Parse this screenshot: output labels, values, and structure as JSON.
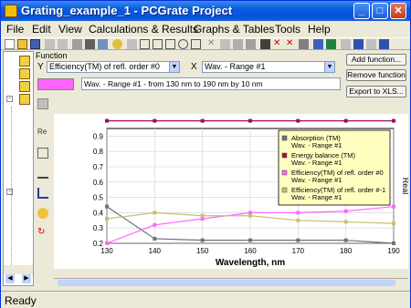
{
  "window": {
    "title": "Grating_example_1 - PCGrate Project",
    "minimize_label": "_",
    "maximize_label": "□",
    "close_label": "✕"
  },
  "menu": [
    "File",
    "Edit",
    "View",
    "Calculations & Results",
    "Graphs & Tables",
    "Tools",
    "Help"
  ],
  "function_panel": {
    "group_label": "Function",
    "y_label": "Y",
    "y_value": "Efficiency(TM) of refl. order #0",
    "x_label": "X",
    "x_value": "Wav. - Range #1",
    "range_text": "Wav. - Range #1 - from 130 nm to 190 nm by 10 nm",
    "add_button": "Add function...",
    "remove_button": "Remove function",
    "export_button": "Export to XLS..."
  },
  "status": {
    "text": "Ready"
  },
  "colors": {
    "title_bar": "#0a5ce0",
    "swatch": "#ff66ff",
    "legend_bg": "#ffffc0"
  },
  "chart_data": {
    "type": "line",
    "x": [
      130,
      140,
      150,
      160,
      170,
      180,
      190
    ],
    "xlabel": "Wavelength, nm",
    "ylabel": "Real",
    "xlim": [
      130,
      190
    ],
    "ylim": [
      0.2,
      0.95
    ],
    "x_ticks": [
      "130",
      "140",
      "150",
      "160",
      "170",
      "180",
      "190"
    ],
    "y_ticks": [
      "0.2",
      "0.3",
      "0.4",
      "0.5",
      "0.6",
      "0.7",
      "0.8",
      "0.9"
    ],
    "grid": true,
    "legend_position": "top-right",
    "series": [
      {
        "name": "Absorption (TM)",
        "sub": "Wav. - Range #1",
        "color": "#707080",
        "values": [
          0.44,
          0.23,
          0.22,
          0.22,
          0.22,
          0.22,
          0.2
        ]
      },
      {
        "name": "Energy balance (TM)",
        "sub": "Wav. - Range #1",
        "color": "#a0104a",
        "values": [
          1.0,
          1.0,
          1.0,
          1.0,
          1.0,
          1.0,
          1.0
        ]
      },
      {
        "name": "Efficiency(TM) of refl. order #0",
        "sub": "Wav. - Range #1",
        "color": "#ff66ff",
        "values": [
          0.2,
          0.32,
          0.36,
          0.4,
          0.4,
          0.41,
          0.44
        ]
      },
      {
        "name": "Efficiency(TM) of refl. order #-1",
        "sub": "Wav. - Range #1",
        "color": "#c8c070",
        "values": [
          0.36,
          0.4,
          0.38,
          0.38,
          0.35,
          0.34,
          0.33
        ]
      }
    ]
  }
}
